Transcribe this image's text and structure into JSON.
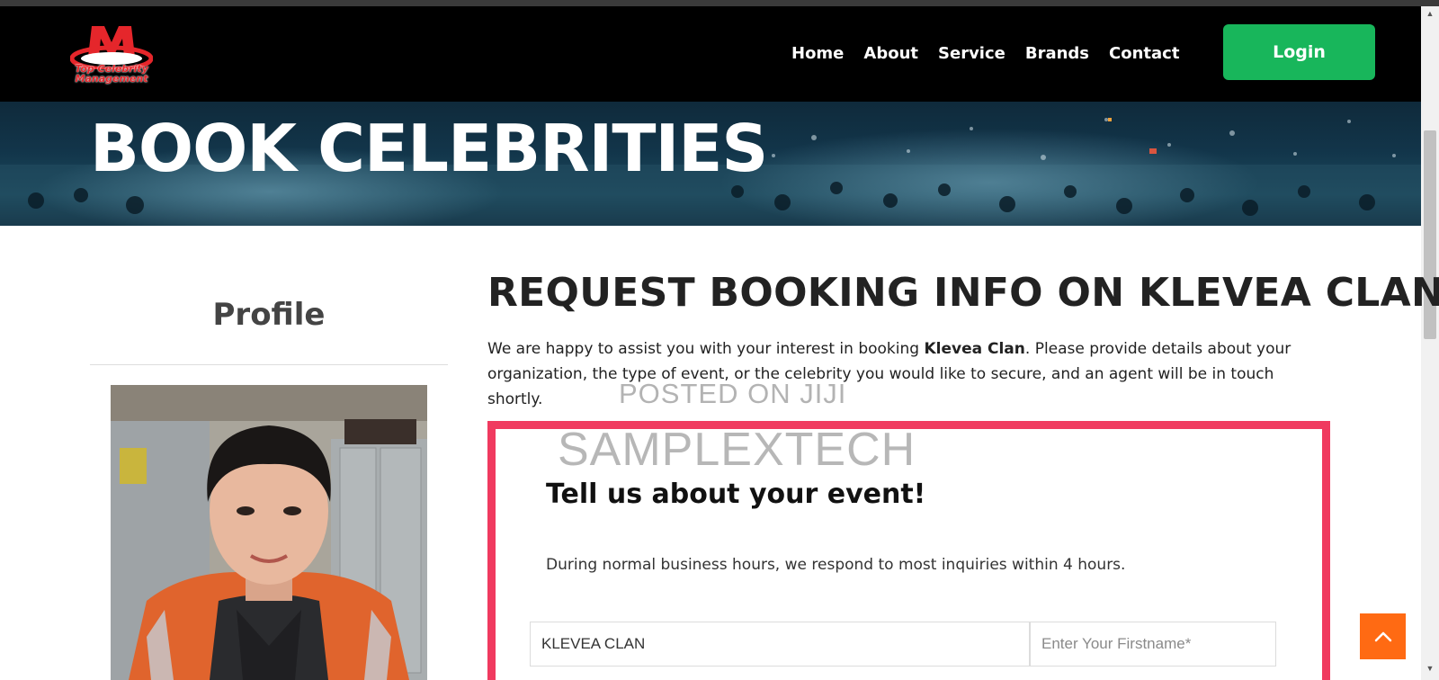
{
  "nav": {
    "logo_text_line1": "Top Celebrity",
    "logo_text_line2": "Management",
    "links": [
      "Home",
      "About",
      "Service",
      "Brands",
      "Contact"
    ],
    "login_label": "Login"
  },
  "hero": {
    "title": "BOOK CELEBRITIES"
  },
  "profile": {
    "title": "Profile"
  },
  "request": {
    "title": "REQUEST BOOKING INFO ON KLEVEA CLAN",
    "desc_before": "We are happy to assist you with your interest in booking ",
    "desc_name": "Klevea Clan",
    "desc_after": ". Please provide details about your organization, the type of event, or the celebrity you would like to secure, and an agent will be in touch shortly."
  },
  "watermarks": {
    "line1": "POSTED ON JIJI",
    "line2": "SAMPLEXTECH"
  },
  "form": {
    "title": "Tell us about your event!",
    "note": "During normal business hours, we respond to most inquiries within 4 hours.",
    "celebrity_value": "KLEVEA CLAN",
    "firstname_placeholder": "Enter Your Firstname*"
  },
  "colors": {
    "nav_bg": "#000000",
    "login_bg": "#18b65b",
    "form_border": "#f03a5f",
    "to_top_bg": "#ff6a13"
  },
  "icons": {
    "to_top": "chevron-up-icon",
    "logo": "logo-icon"
  }
}
